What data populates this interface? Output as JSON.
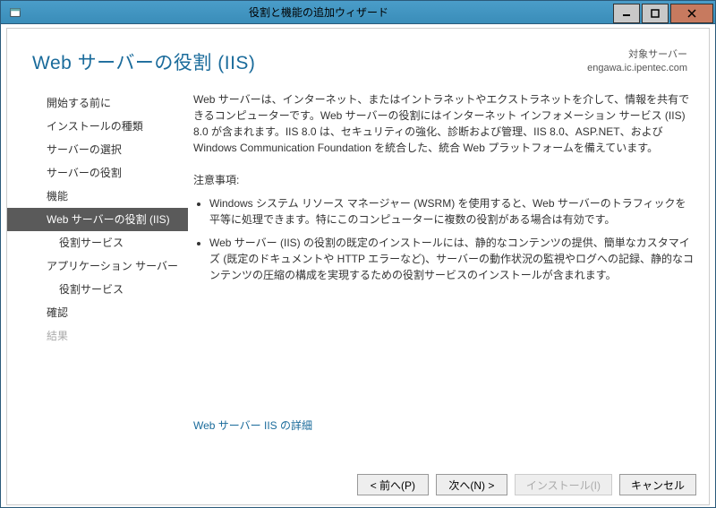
{
  "titlebar": {
    "title": "役割と機能の追加ウィザード"
  },
  "header": {
    "page_title": "Web サーバーの役割 (IIS)",
    "server_label": "対象サーバー",
    "server_name": "engawa.ic.ipentec.com"
  },
  "sidebar": {
    "items": [
      {
        "label": "開始する前に",
        "selected": false,
        "sub": false,
        "disabled": false
      },
      {
        "label": "インストールの種類",
        "selected": false,
        "sub": false,
        "disabled": false
      },
      {
        "label": "サーバーの選択",
        "selected": false,
        "sub": false,
        "disabled": false
      },
      {
        "label": "サーバーの役割",
        "selected": false,
        "sub": false,
        "disabled": false
      },
      {
        "label": "機能",
        "selected": false,
        "sub": false,
        "disabled": false
      },
      {
        "label": "Web サーバーの役割 (IIS)",
        "selected": true,
        "sub": false,
        "disabled": false
      },
      {
        "label": "役割サービス",
        "selected": false,
        "sub": true,
        "disabled": false
      },
      {
        "label": "アプリケーション サーバー",
        "selected": false,
        "sub": false,
        "disabled": false
      },
      {
        "label": "役割サービス",
        "selected": false,
        "sub": true,
        "disabled": false
      },
      {
        "label": "確認",
        "selected": false,
        "sub": false,
        "disabled": false
      },
      {
        "label": "結果",
        "selected": false,
        "sub": false,
        "disabled": true
      }
    ]
  },
  "main": {
    "description": "Web サーバーは、インターネット、またはイントラネットやエクストラネットを介して、情報を共有できるコンピューターです。Web サーバーの役割にはインターネット インフォメーション サービス (IIS) 8.0 が含まれます。IIS 8.0 は、セキュリティの強化、診断および管理、IIS 8.0、ASP.NET、および Windows Communication Foundation を統合した、統合 Web プラットフォームを備えています。",
    "notes_header": "注意事項:",
    "bullets": [
      "Windows システム リソース マネージャー (WSRM) を使用すると、Web サーバーのトラフィックを平等に処理できます。特にこのコンピューターに複数の役割がある場合は有効です。",
      "Web サーバー (IIS) の役割の既定のインストールには、静的なコンテンツの提供、簡単なカスタマイズ (既定のドキュメントや HTTP エラーなど)、サーバーの動作状況の監視やログへの記録、静的なコンテンツの圧縮の構成を実現するための役割サービスのインストールが含まれます。"
    ],
    "link": "Web サーバー IIS の詳細"
  },
  "footer": {
    "prev": "< 前へ(P)",
    "next": "次へ(N) >",
    "install": "インストール(I)",
    "cancel": "キャンセル"
  }
}
